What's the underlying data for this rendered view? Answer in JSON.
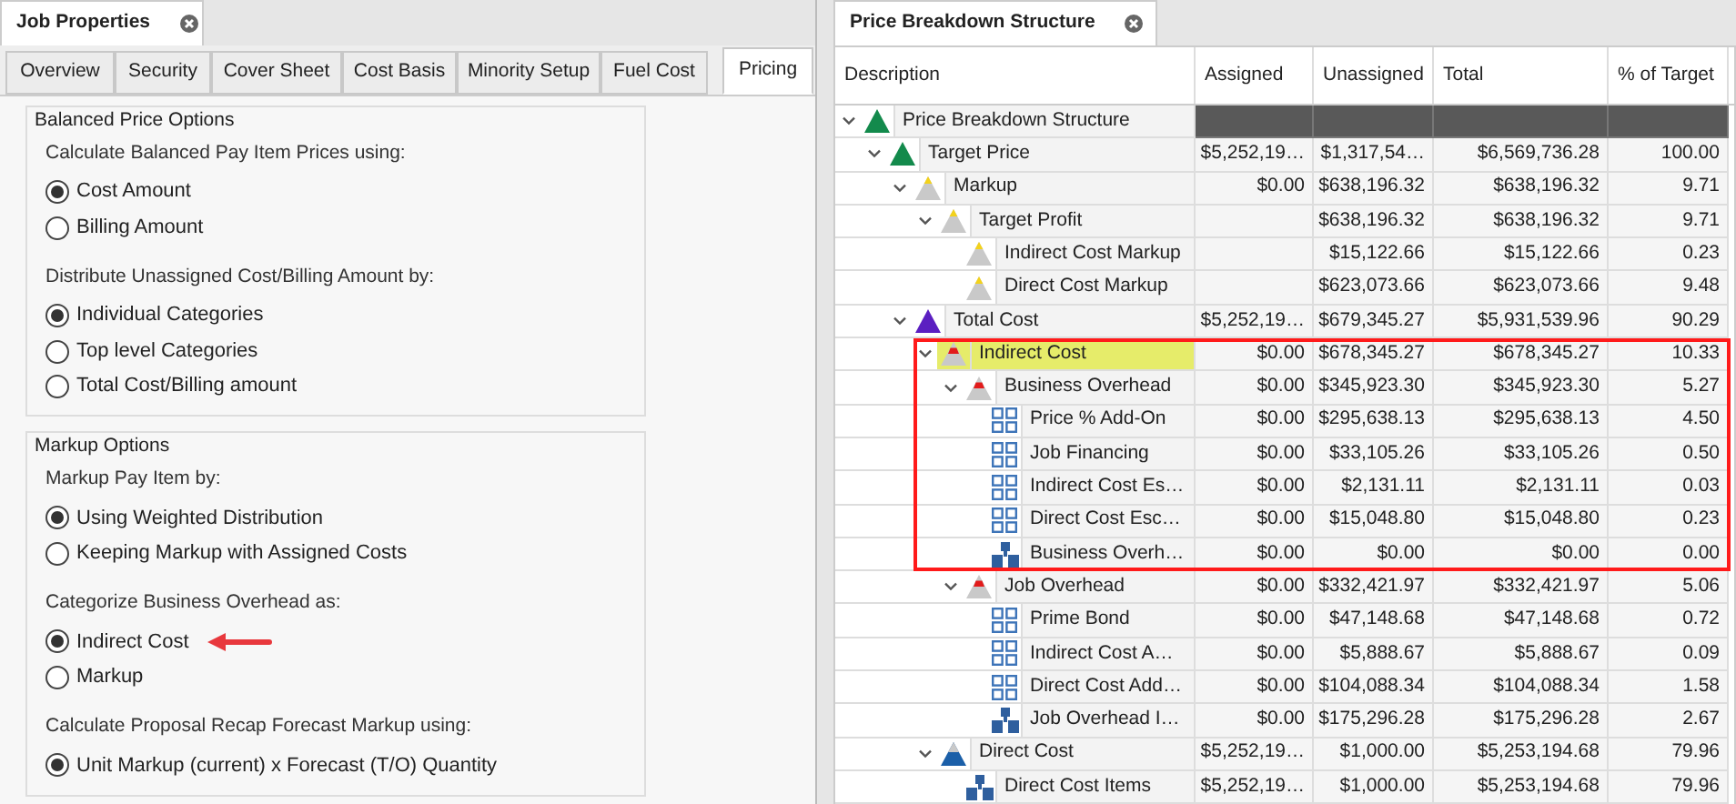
{
  "left_panel": {
    "document_tab": {
      "title": "Job Properties"
    },
    "tabs": [
      {
        "label": "Overview",
        "selected": false
      },
      {
        "label": "Security",
        "selected": false
      },
      {
        "label": "Cover Sheet",
        "selected": false
      },
      {
        "label": "Cost Basis",
        "selected": false
      },
      {
        "label": "Minority Setup",
        "selected": false
      },
      {
        "label": "Fuel Cost",
        "selected": false
      },
      {
        "label": "Pricing",
        "selected": true
      }
    ],
    "groups": [
      {
        "title": "Balanced Price Options",
        "questions": [
          {
            "prompt": "Calculate Balanced Pay Item Prices using:",
            "options": [
              {
                "label": "Cost Amount",
                "selected": true,
                "arrow": false
              },
              {
                "label": "Billing Amount",
                "selected": false,
                "arrow": false
              }
            ]
          },
          {
            "prompt": "Distribute Unassigned Cost/Billing Amount by:",
            "options": [
              {
                "label": "Individual Categories",
                "selected": true,
                "arrow": false
              },
              {
                "label": "Top level Categories",
                "selected": false,
                "arrow": false
              },
              {
                "label": "Total Cost/Billing amount",
                "selected": false,
                "arrow": false
              }
            ]
          }
        ]
      },
      {
        "title": "Markup Options",
        "questions": [
          {
            "prompt": "Markup Pay Item by:",
            "options": [
              {
                "label": "Using Weighted Distribution",
                "selected": true,
                "arrow": false
              },
              {
                "label": "Keeping Markup with Assigned Costs",
                "selected": false,
                "arrow": false
              }
            ]
          },
          {
            "prompt": "Categorize Business Overhead as:",
            "options": [
              {
                "label": "Indirect Cost",
                "selected": true,
                "arrow": true
              },
              {
                "label": "Markup",
                "selected": false,
                "arrow": false
              }
            ]
          },
          {
            "prompt": "Calculate Proposal Recap Forecast Markup using:",
            "options": [
              {
                "label": "Unit Markup (current) x Forecast (T/O) Quantity",
                "selected": true,
                "arrow": false
              }
            ]
          }
        ]
      }
    ]
  },
  "right_panel": {
    "document_tab": {
      "title": "Price Breakdown Structure"
    },
    "columns": [
      "Description",
      "Assigned",
      "Unassigned",
      "Total",
      "% of Target"
    ],
    "rows": [
      {
        "description": "Price Breakdown Structure",
        "kind": "green",
        "expanded": true,
        "highlighted": false,
        "boxed": false,
        "children": [
          {
            "description": "Target Price",
            "kind": "green",
            "expanded": true,
            "highlighted": false,
            "boxed": false,
            "assigned": "$5,252,19…",
            "unassigned": "$1,317,54…",
            "total": "$6,569,736.28",
            "percent": "100.00",
            "children": [
              {
                "description": "Markup",
                "kind": "markup",
                "expanded": true,
                "highlighted": false,
                "boxed": false,
                "assigned": "$0.00",
                "unassigned": "$638,196.32",
                "total": "$638,196.32",
                "percent": "9.71",
                "children": [
                  {
                    "description": "Target Profit",
                    "kind": "markup",
                    "expanded": true,
                    "highlighted": false,
                    "boxed": false,
                    "unassigned": "$638,196.32",
                    "total": "$638,196.32",
                    "percent": "9.71",
                    "children": [
                      {
                        "description": "Indirect Cost Markup",
                        "kind": "markup",
                        "highlighted": false,
                        "boxed": false,
                        "unassigned": "$15,122.66",
                        "total": "$15,122.66",
                        "percent": "0.23"
                      },
                      {
                        "description": "Direct Cost Markup",
                        "kind": "markup",
                        "highlighted": false,
                        "boxed": false,
                        "unassigned": "$623,073.66",
                        "total": "$623,073.66",
                        "percent": "9.48"
                      }
                    ]
                  }
                ]
              },
              {
                "description": "Total Cost",
                "kind": "cost",
                "expanded": true,
                "highlighted": false,
                "boxed": false,
                "assigned": "$5,252,19…",
                "unassigned": "$679,345.27",
                "total": "$5,931,539.96",
                "percent": "90.29",
                "children": [
                  {
                    "description": "Indirect Cost",
                    "kind": "overhead",
                    "expanded": true,
                    "highlighted": true,
                    "boxed": true,
                    "assigned": "$0.00",
                    "unassigned": "$678,345.27",
                    "total": "$678,345.27",
                    "percent": "10.33",
                    "children": [
                      {
                        "description": "Business Overhead",
                        "kind": "overhead",
                        "expanded": true,
                        "highlighted": false,
                        "boxed": true,
                        "assigned": "$0.00",
                        "unassigned": "$345,923.30",
                        "total": "$345,923.30",
                        "percent": "5.27",
                        "children": [
                          {
                            "description": "Price % Add-On",
                            "kind": "addon",
                            "highlighted": false,
                            "boxed": true,
                            "assigned": "$0.00",
                            "unassigned": "$295,638.13",
                            "total": "$295,638.13",
                            "percent": "4.50"
                          },
                          {
                            "description": "Job Financing",
                            "kind": "addon",
                            "highlighted": false,
                            "boxed": true,
                            "assigned": "$0.00",
                            "unassigned": "$33,105.26",
                            "total": "$33,105.26",
                            "percent": "0.50"
                          },
                          {
                            "description": "Indirect Cost Es…",
                            "kind": "addon",
                            "highlighted": false,
                            "boxed": true,
                            "assigned": "$0.00",
                            "unassigned": "$2,131.11",
                            "total": "$2,131.11",
                            "percent": "0.03"
                          },
                          {
                            "description": "Direct Cost Esc…",
                            "kind": "addon",
                            "highlighted": false,
                            "boxed": true,
                            "assigned": "$0.00",
                            "unassigned": "$15,048.80",
                            "total": "$15,048.80",
                            "percent": "0.23"
                          },
                          {
                            "description": "Business Overh…",
                            "kind": "items",
                            "highlighted": false,
                            "boxed": true,
                            "assigned": "$0.00",
                            "unassigned": "$0.00",
                            "total": "$0.00",
                            "percent": "0.00"
                          }
                        ]
                      },
                      {
                        "description": "Job Overhead",
                        "kind": "overhead",
                        "expanded": true,
                        "highlighted": false,
                        "boxed": false,
                        "assigned": "$0.00",
                        "unassigned": "$332,421.97",
                        "total": "$332,421.97",
                        "percent": "5.06",
                        "children": [
                          {
                            "description": "Prime Bond",
                            "kind": "addon",
                            "highlighted": false,
                            "boxed": false,
                            "assigned": "$0.00",
                            "unassigned": "$47,148.68",
                            "total": "$47,148.68",
                            "percent": "0.72"
                          },
                          {
                            "description": "Indirect Cost A…",
                            "kind": "addon",
                            "highlighted": false,
                            "boxed": false,
                            "assigned": "$0.00",
                            "unassigned": "$5,888.67",
                            "total": "$5,888.67",
                            "percent": "0.09"
                          },
                          {
                            "description": "Direct Cost Add…",
                            "kind": "addon",
                            "highlighted": false,
                            "boxed": false,
                            "assigned": "$0.00",
                            "unassigned": "$104,088.34",
                            "total": "$104,088.34",
                            "percent": "1.58"
                          },
                          {
                            "description": "Job Overhead I…",
                            "kind": "items",
                            "highlighted": false,
                            "boxed": false,
                            "assigned": "$0.00",
                            "unassigned": "$175,296.28",
                            "total": "$175,296.28",
                            "percent": "2.67"
                          }
                        ]
                      }
                    ]
                  },
                  {
                    "description": "Direct Cost",
                    "kind": "direct",
                    "expanded": true,
                    "highlighted": false,
                    "boxed": false,
                    "assigned": "$5,252,19…",
                    "unassigned": "$1,000.00",
                    "total": "$5,253,194.68",
                    "percent": "79.96",
                    "children": [
                      {
                        "description": "Direct Cost Items",
                        "kind": "items",
                        "highlighted": false,
                        "boxed": false,
                        "assigned": "$5,252,19…",
                        "unassigned": "$1,000.00",
                        "total": "$5,253,194.68",
                        "percent": "79.96"
                      }
                    ]
                  }
                ]
              }
            ]
          }
        ]
      }
    ]
  }
}
